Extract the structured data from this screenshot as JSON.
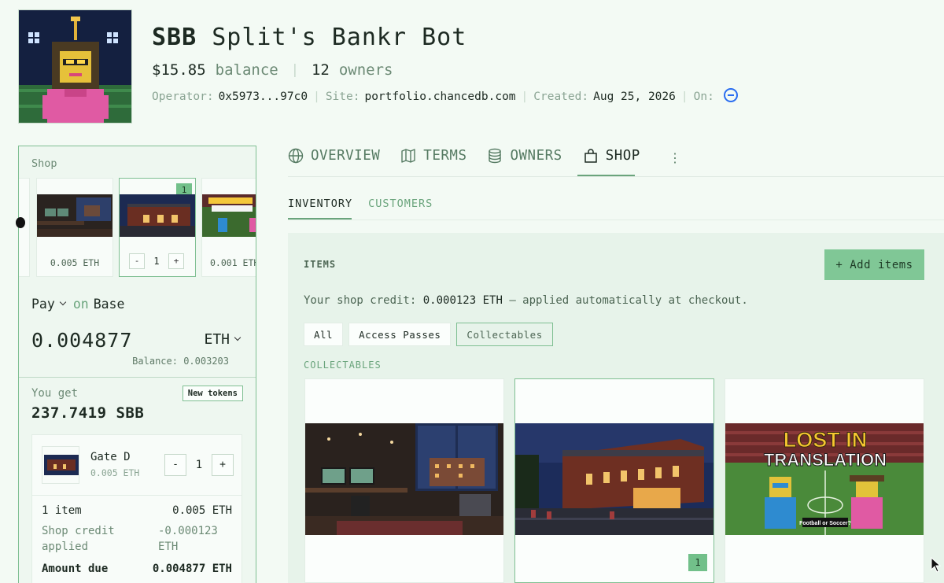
{
  "bot": {
    "ticker": "SBB",
    "name": "Split's Bankr Bot",
    "balance": "$15.85",
    "balance_label": "balance",
    "owners_count": "12",
    "owners_label": "owners",
    "operator_label": "Operator:",
    "operator": "0x5973...97c0",
    "site_label": "Site:",
    "site": "portfolio.chancedb.com",
    "created_label": "Created:",
    "created": "Aug 25, 2026",
    "on_label": "On:"
  },
  "shop_panel": {
    "label": "Shop",
    "carousel": [
      {
        "price": "0.005 ETH",
        "image": "room-night"
      },
      {
        "qty": "1",
        "badge": "1",
        "image": "stadium-night",
        "minus": "-",
        "plus": "+"
      },
      {
        "price": "0.001 ETH",
        "image": "lost-in-translation"
      }
    ],
    "pay_label": "Pay",
    "on_label": "on",
    "network": "Base",
    "amount": "0.004877",
    "currency": "ETH",
    "balance": "Balance: 0.003203",
    "you_get_label": "You get",
    "new_tokens": "New tokens",
    "receive_amount": "237.7419 SBB",
    "cart": {
      "item_name": "Gate D",
      "item_price": "0.005 ETH",
      "qty": "1",
      "minus": "-",
      "plus": "+",
      "items_label": "1 item",
      "items_total": "0.005 ETH",
      "credit_label_1": "Shop credit",
      "credit_label_2": "applied",
      "credit_value_1": "-0.000123",
      "credit_value_2": "ETH",
      "due_label": "Amount due",
      "due_value": "0.004877 ETH"
    }
  },
  "tabs": [
    {
      "label": "OVERVIEW",
      "icon": "globe-icon"
    },
    {
      "label": "TERMS",
      "icon": "map-icon"
    },
    {
      "label": "OWNERS",
      "icon": "database-icon"
    },
    {
      "label": "SHOP",
      "icon": "shopping-bag-icon",
      "active": true
    }
  ],
  "more": "⋮",
  "subtabs": [
    {
      "label": "INVENTORY",
      "active": true
    },
    {
      "label": "CUSTOMERS"
    }
  ],
  "items_panel": {
    "title": "ITEMS",
    "add_button": "+ Add items",
    "credit_prefix": "Your shop credit:",
    "credit_value": "0.000123 ETH",
    "credit_suffix": "— applied automatically at checkout.",
    "filters": [
      "All",
      "Access Passes",
      "Collectables"
    ],
    "active_filter": "Collectables",
    "section": "COLLECTABLES",
    "items": [
      {
        "image": "room-night"
      },
      {
        "image": "stadium-night",
        "badge": "1"
      },
      {
        "image": "lost-in-translation",
        "img_title_1": "LOST IN",
        "img_title_2": "TRANSLATION",
        "img_caption": "Football or Soccer?"
      }
    ]
  },
  "colors": {
    "accent": "#80c796",
    "border": "#7fbf92",
    "background": "#f3faf4",
    "link_blue": "#2a6df0"
  }
}
